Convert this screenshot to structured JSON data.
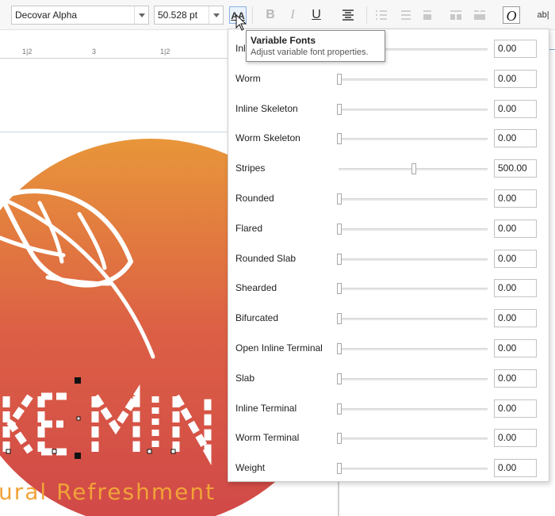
{
  "toolbar": {
    "font_family": "Decovar Alpha",
    "font_size": "50.528 pt",
    "variable_fonts_icon": "AA",
    "bold_icon": "B",
    "italic_icon": "I",
    "underline_icon": "U",
    "text_tool_label": "ab|"
  },
  "ruler": {
    "labels": [
      "1|2",
      "3",
      "1|2"
    ]
  },
  "tooltip": {
    "title": "Variable Fonts",
    "description": "Adjust variable font properties."
  },
  "panel": {
    "rows": [
      {
        "name": "Inline",
        "value": "0.00",
        "position": 0
      },
      {
        "name": "Worm",
        "value": "0.00",
        "position": 0
      },
      {
        "name": "Inline Skeleton",
        "value": "0.00",
        "position": 0
      },
      {
        "name": "Worm Skeleton",
        "value": "0.00",
        "position": 0
      },
      {
        "name": "Stripes",
        "value": "500.00",
        "position": 0.5
      },
      {
        "name": "Rounded",
        "value": "0.00",
        "position": 0
      },
      {
        "name": "Flared",
        "value": "0.00",
        "position": 0
      },
      {
        "name": "Rounded Slab",
        "value": "0.00",
        "position": 0
      },
      {
        "name": "Shearded",
        "value": "0.00",
        "position": 0
      },
      {
        "name": "Bifurcated",
        "value": "0.00",
        "position": 0
      },
      {
        "name": "Open Inline Terminal",
        "value": "0.00",
        "position": 0
      },
      {
        "name": "Slab",
        "value": "0.00",
        "position": 0
      },
      {
        "name": "Inline Terminal",
        "value": "0.00",
        "position": 0
      },
      {
        "name": "Worm Terminal",
        "value": "0.00",
        "position": 0
      },
      {
        "name": "Weight",
        "value": "0.00",
        "position": 0
      }
    ]
  },
  "artwork": {
    "headline": "KE MIN",
    "tagline": "ural Refreshment",
    "gradient_top": "#e8963a",
    "gradient_bottom": "#d24a4a",
    "tagline_color": "#f1a338"
  }
}
